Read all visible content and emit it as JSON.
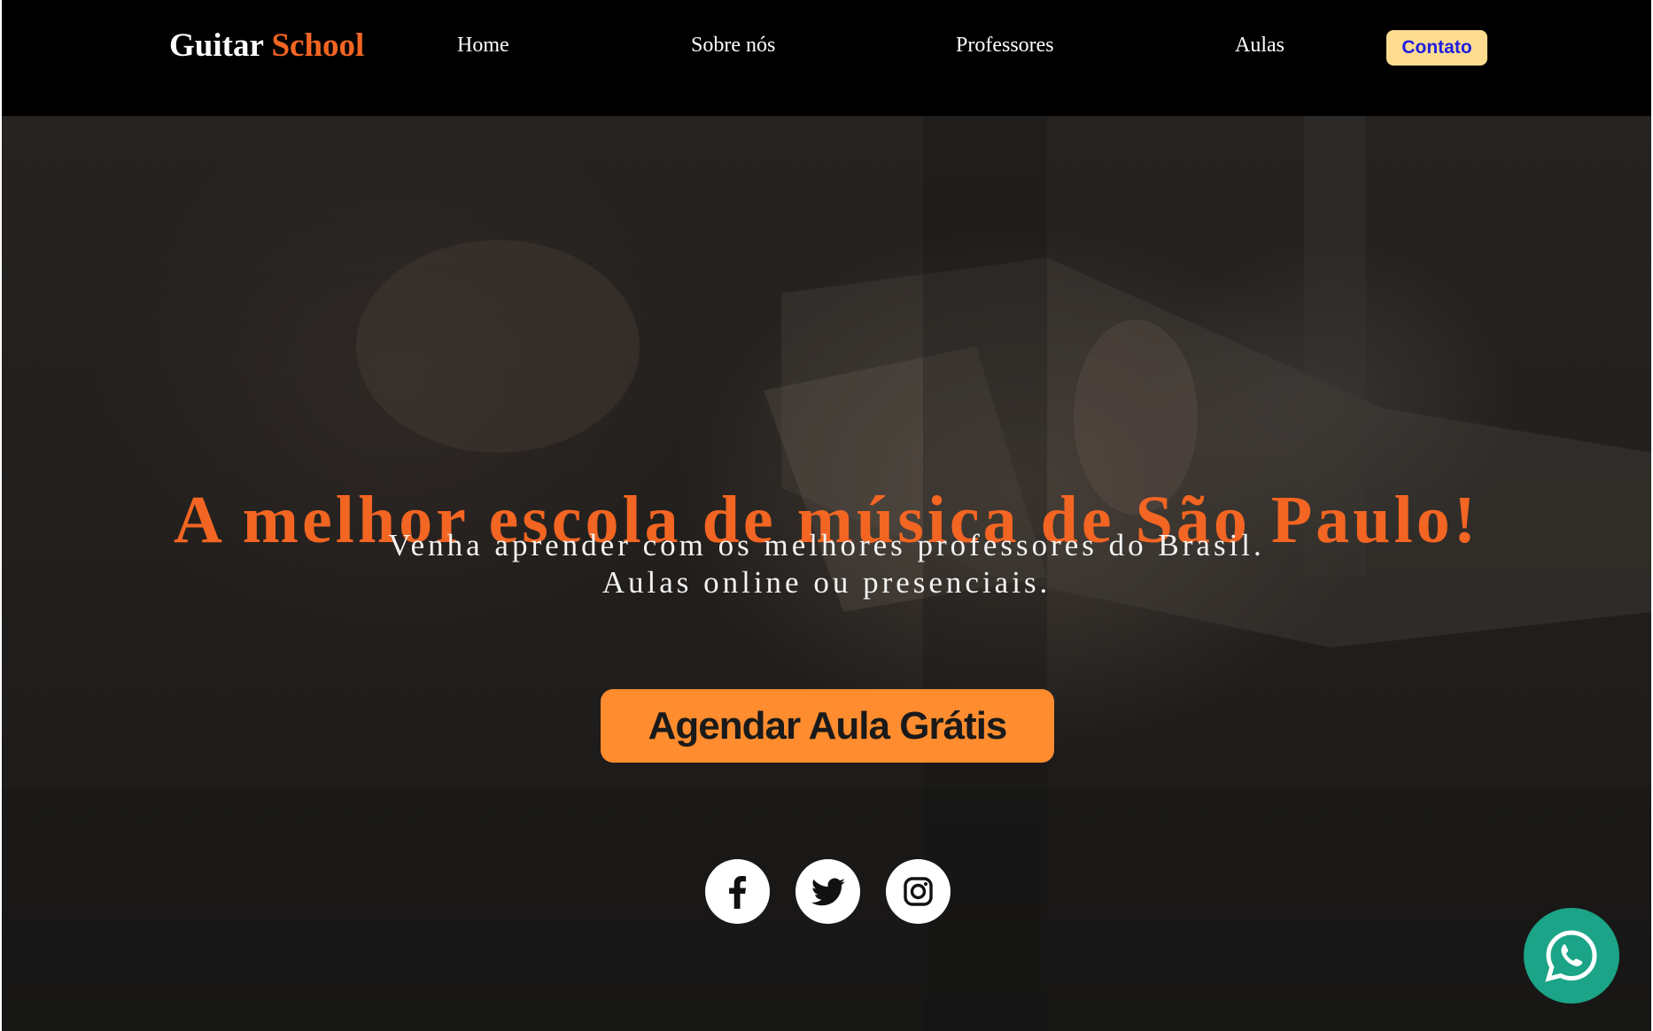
{
  "brand": {
    "name_part1": "Guitar",
    "name_part2": "School",
    "accent_color": "#f26522"
  },
  "nav": {
    "items": [
      {
        "label": "Home"
      },
      {
        "label": "Sobre nós"
      },
      {
        "label": "Professores"
      },
      {
        "label": "Aulas"
      }
    ],
    "contact_label": "Contato"
  },
  "hero": {
    "headline": "A melhor escola de música de São Paulo!",
    "subline_1": "Venha aprender com os melhores professores do Brasil.",
    "subline_2": "Aulas online ou presenciais.",
    "cta_label": "Agendar Aula Grátis",
    "cta_color": "#ff8c2e"
  },
  "social": [
    {
      "icon": "facebook-icon"
    },
    {
      "icon": "twitter-icon"
    },
    {
      "icon": "instagram-icon"
    }
  ],
  "floating": {
    "icon": "whatsapp-icon",
    "color": "#1ba487"
  }
}
